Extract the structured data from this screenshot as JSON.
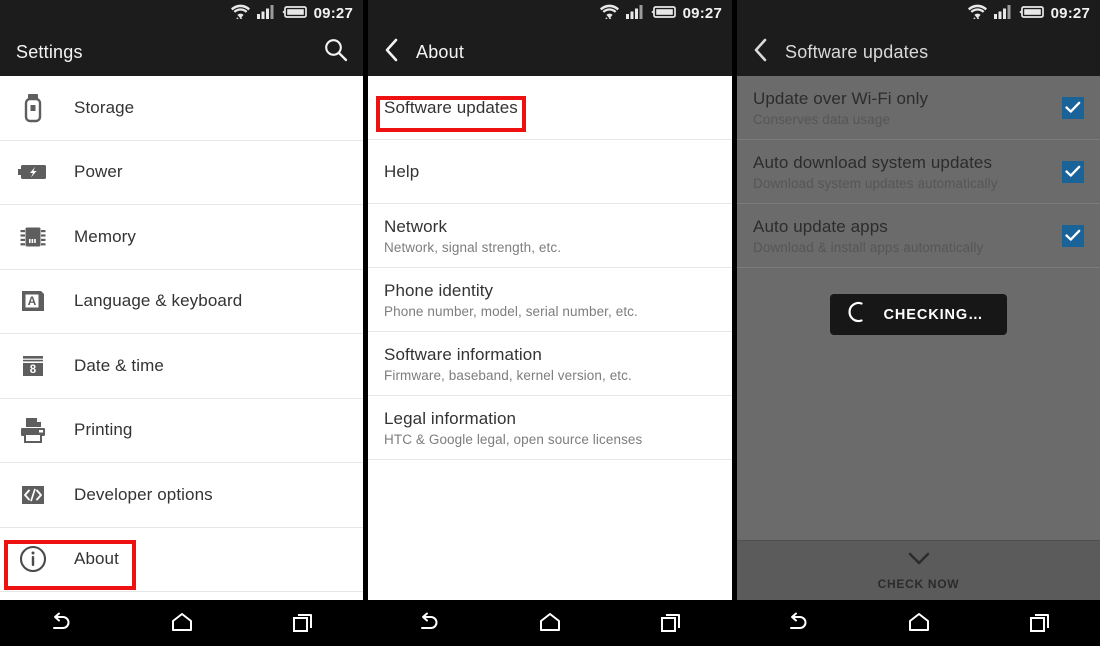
{
  "status_bar": {
    "time": "09:27",
    "icons": [
      "wifi-icon",
      "cellular-signal-icon",
      "battery-icon"
    ]
  },
  "colors": {
    "status_bar_bg": "#1c1c1c",
    "title_bar_bg": "#1c1c1c",
    "panel_bg": "#ffffff",
    "dimmed_panel_bg": "#6b6b6b",
    "checkbox_accent": "#1a6399",
    "annotation_red": "#ee1111",
    "nav_bar_bg": "#000000"
  },
  "panel_settings": {
    "title": "Settings",
    "search_icon": "search-icon",
    "items": [
      {
        "label": "Storage",
        "icon": "usb-drive-icon"
      },
      {
        "label": "Power",
        "icon": "battery-bolt-icon"
      },
      {
        "label": "Memory",
        "icon": "memory-chip-icon"
      },
      {
        "label": "Language & keyboard",
        "icon": "keyboard-a-icon"
      },
      {
        "label": "Date & time",
        "icon": "calendar-icon"
      },
      {
        "label": "Printing",
        "icon": "printer-icon"
      },
      {
        "label": "Developer options",
        "icon": "code-brackets-icon"
      },
      {
        "label": "About",
        "icon": "info-circle-icon",
        "highlighted": true
      }
    ]
  },
  "panel_about": {
    "title": "About",
    "back_icon": "back-chevron-icon",
    "items": [
      {
        "title": "Software updates",
        "subtitle": "",
        "highlighted": true
      },
      {
        "title": "Help",
        "subtitle": ""
      },
      {
        "title": "Network",
        "subtitle": "Network, signal strength, etc."
      },
      {
        "title": "Phone identity",
        "subtitle": "Phone number, model, serial number, etc."
      },
      {
        "title": "Software information",
        "subtitle": "Firmware, baseband, kernel version, etc."
      },
      {
        "title": "Legal information",
        "subtitle": "HTC & Google legal, open source licenses"
      }
    ]
  },
  "panel_updates": {
    "title": "Software updates",
    "back_icon": "back-chevron-icon",
    "items": [
      {
        "title": "Update over Wi-Fi only",
        "subtitle": "Conserves data usage",
        "checked": true
      },
      {
        "title": "Auto download system updates",
        "subtitle": "Download system updates automatically",
        "checked": true
      },
      {
        "title": "Auto update apps",
        "subtitle": "Download & install apps automatically",
        "checked": true
      }
    ],
    "checking_button": {
      "label": "CHECKING…",
      "icon": "spinner-icon"
    },
    "action_bar": {
      "label": "CHECK NOW",
      "icon": "checkmark-icon"
    }
  },
  "nav_bar": {
    "buttons": [
      {
        "name": "back",
        "icon": "back-arrow-icon"
      },
      {
        "name": "home",
        "icon": "home-icon"
      },
      {
        "name": "recents",
        "icon": "recents-icon"
      }
    ]
  }
}
